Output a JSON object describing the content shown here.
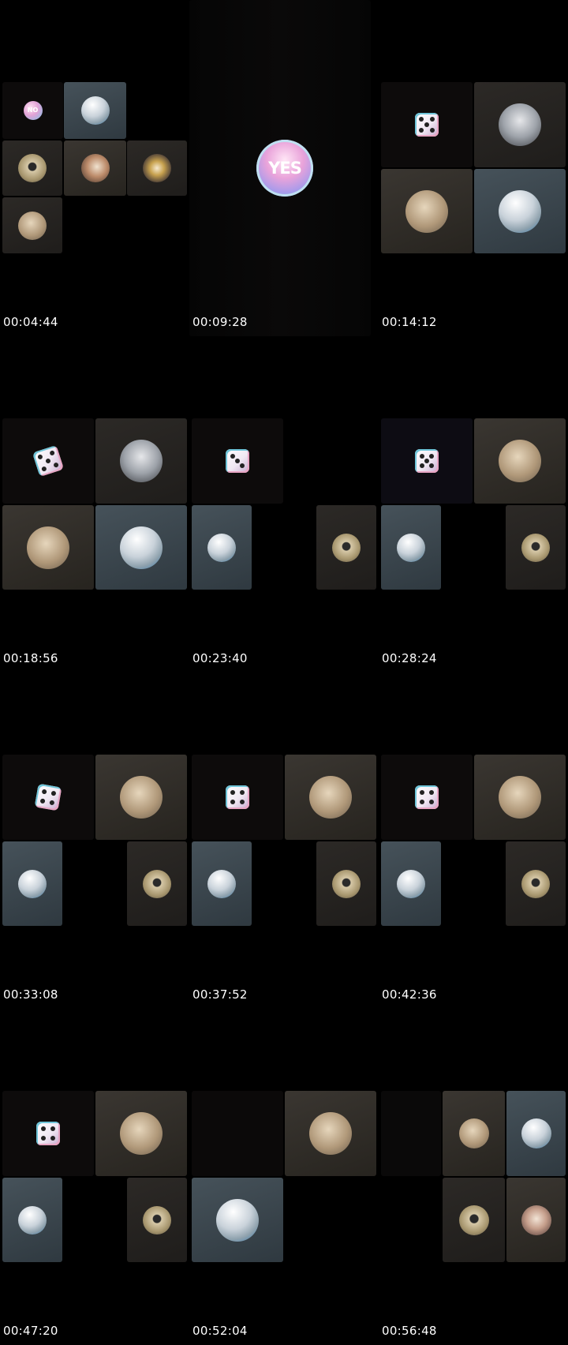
{
  "frames": [
    {
      "time": "00:04:44",
      "overlay": "NO"
    },
    {
      "time": "00:09:28",
      "overlay": "YES"
    },
    {
      "time": "00:14:12"
    },
    {
      "time": "00:18:56"
    },
    {
      "time": "00:23:40"
    },
    {
      "time": "00:28:24"
    },
    {
      "time": "00:33:08"
    },
    {
      "time": "00:37:52"
    },
    {
      "time": "00:42:36"
    },
    {
      "time": "00:47:20"
    },
    {
      "time": "00:52:04"
    },
    {
      "time": "00:56:48"
    }
  ],
  "colors": {
    "background": "#000000",
    "tile_warm": "#2c2926",
    "tile_slate": "#46525a",
    "badge_pink": "#e9a3da",
    "badge_cyan": "#6dc7e6"
  },
  "icons": {
    "dice": "dice-icon",
    "no_badge": "no-badge-icon",
    "yes_badge": "yes-badge-icon",
    "avatar": "participant-avatar"
  }
}
